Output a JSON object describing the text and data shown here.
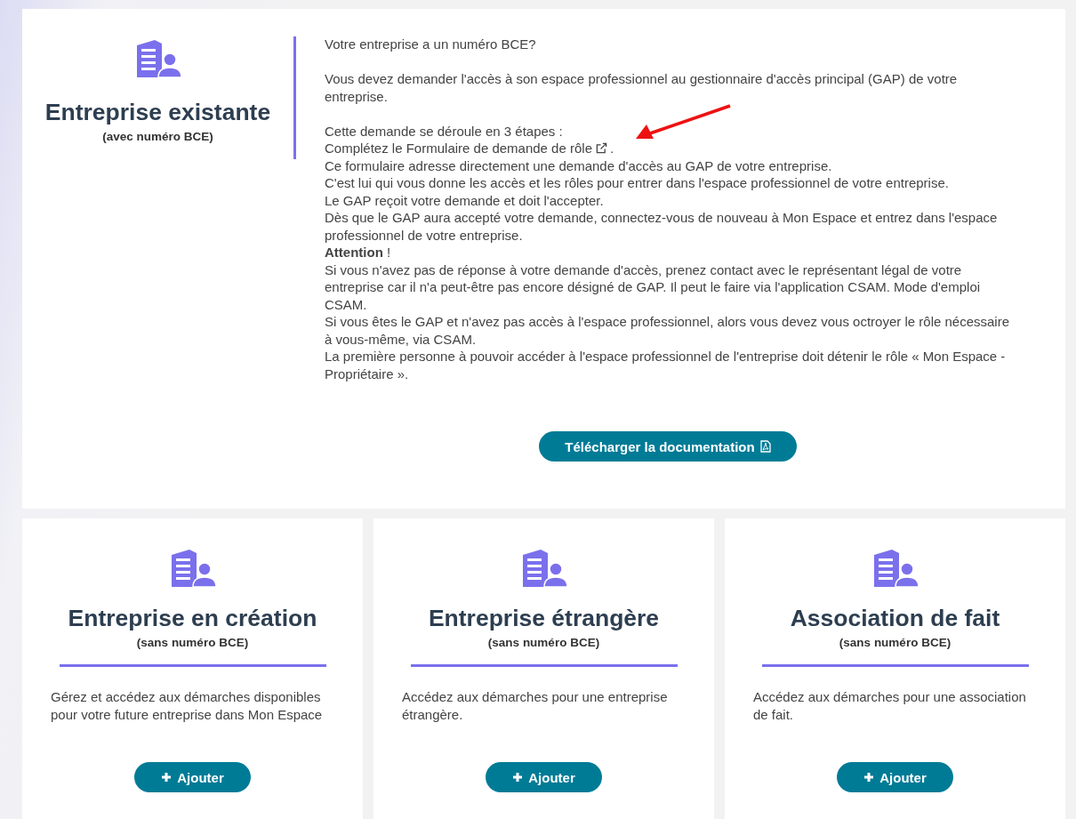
{
  "main_card": {
    "title": "Entreprise existante",
    "subtitle": "(avec numéro BCE)",
    "question": "Votre entreprise a un numéro BCE?",
    "paragraph": "Vous devez demander l'accès à son espace professionnel au gestionnaire d'accès principal (GAP) de votre entreprise.",
    "steps_heading": "Cette demande se déroule en 3 étapes :",
    "link_line": {
      "link": "Complétez le Formulaire de demande de rôle",
      "after": "."
    },
    "lines": [
      {
        "text": "Ce formulaire adresse directement une demande d'accès au GAP de votre entreprise."
      },
      {
        "text": "C'est lui qui vous donne les accès et les rôles pour entrer dans l'espace professionnel de votre entreprise."
      },
      {
        "text": "Le GAP reçoit votre demande et doit l'accepter."
      },
      {
        "text": "Dès que le GAP aura accepté votre demande, connectez-vous de nouveau à Mon Espace et entrez dans l'espace professionnel de votre entreprise."
      },
      {
        "text": "**Attention** !"
      },
      {
        "text": "Si vous n'avez pas de réponse à votre demande d'accès, prenez contact avec le représentant légal de votre entreprise car il n'a peut-être pas encore désigné de GAP. Il peut le faire via l'application CSAM. Mode d'emploi CSAM."
      },
      {
        "text": "Si vous êtes le GAP et n'avez pas accès à l'espace professionnel, alors vous devez vous octroyer le rôle nécessaire à vous-même, via CSAM."
      },
      {
        "text": "La première personne à pouvoir accéder à l'espace professionnel de l'entreprise doit détenir le rôle « Mon Espace - Propriétaire »."
      }
    ],
    "button": "Télécharger la documentation"
  },
  "cards": [
    {
      "title": "Entreprise en création",
      "subtitle": "(sans numéro BCE)",
      "description": "Gérez et accédez aux démarches disponibles pour votre future entreprise dans Mon Espace",
      "button": "Ajouter"
    },
    {
      "title": "Entreprise étrangère",
      "subtitle": "(sans numéro BCE)",
      "description": "Accédez aux démarches pour une entreprise étrangère.",
      "button": "Ajouter"
    },
    {
      "title": "Association de fait",
      "subtitle": "(sans numéro BCE)",
      "description": "Accédez aux démarches pour une association de fait.",
      "button": "Ajouter"
    }
  ]
}
